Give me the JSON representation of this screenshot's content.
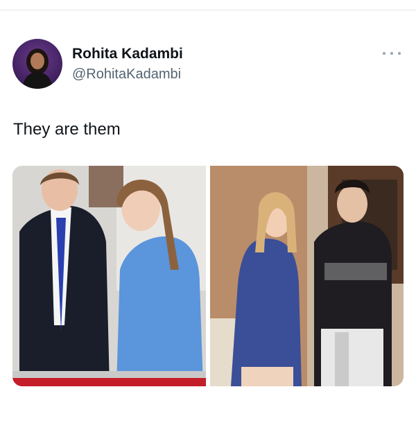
{
  "author": {
    "display_name": "Rohita Kadambi",
    "handle": "@RohitaKadambi",
    "avatar_icon": "profile-photo"
  },
  "more_icon": "ellipsis-icon",
  "tweet": {
    "text": "They are them"
  },
  "media": [
    {
      "icon": "photo-children-at-event"
    },
    {
      "icon": "photo-tv-show-scene"
    }
  ],
  "colors": {
    "name": "#0f1419",
    "handle": "#536471",
    "more": "#9aa4ad",
    "divider": "#e6e6e6"
  }
}
